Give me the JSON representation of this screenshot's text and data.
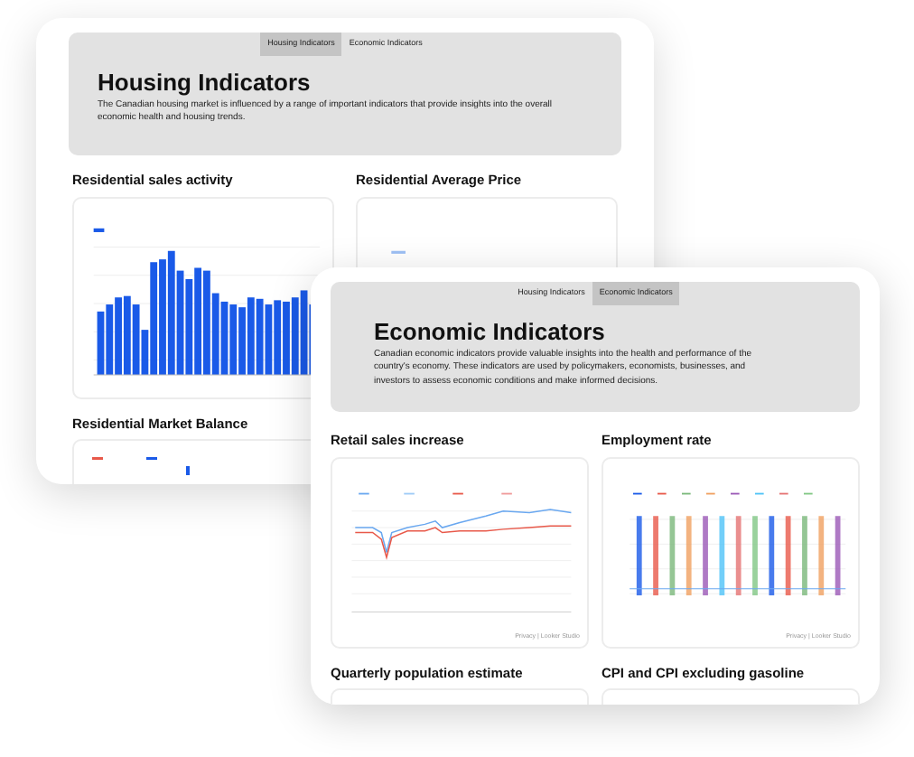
{
  "windows": [
    {
      "tabs": [
        {
          "label": "Housing Indicators",
          "selected": true
        },
        {
          "label": "Economic Indicators",
          "selected": false
        }
      ],
      "heading": "Housing Indicators",
      "description": "The Canadian housing market is influenced by a range of important indicators that provide insights into the overall economic health and housing trends.",
      "sections": [
        {
          "title": "Residential sales activity",
          "chart": {
            "kind": "bars"
          }
        },
        {
          "title": "Residential Average Price",
          "chart": {
            "kind": "sparse"
          }
        },
        {
          "title": "Residential Market Balance",
          "chart": {
            "kind": "legend-only"
          }
        }
      ]
    },
    {
      "tabs": [
        {
          "label": "Housing Indicators",
          "selected": false
        },
        {
          "label": "Economic Indicators",
          "selected": true
        }
      ],
      "heading": "Economic Indicators",
      "description": "Canadian economic indicators provide valuable insights into the health and performance of the country's economy. These indicators are used by policymakers, economists, businesses, and investors to assess economic conditions and make informed decisions.",
      "sections": [
        {
          "title": "Retail sales increase",
          "chart": {
            "kind": "lines"
          },
          "footer": "Privacy | Looker Studio"
        },
        {
          "title": "Employment rate",
          "chart": {
            "kind": "spikes"
          },
          "footer": "Privacy | Looker Studio"
        },
        {
          "title": "Quarterly population estimate",
          "chart": {
            "kind": "empty"
          }
        },
        {
          "title": "CPI and CPI excluding gasoline",
          "chart": {
            "kind": "empty"
          }
        }
      ]
    }
  ]
}
